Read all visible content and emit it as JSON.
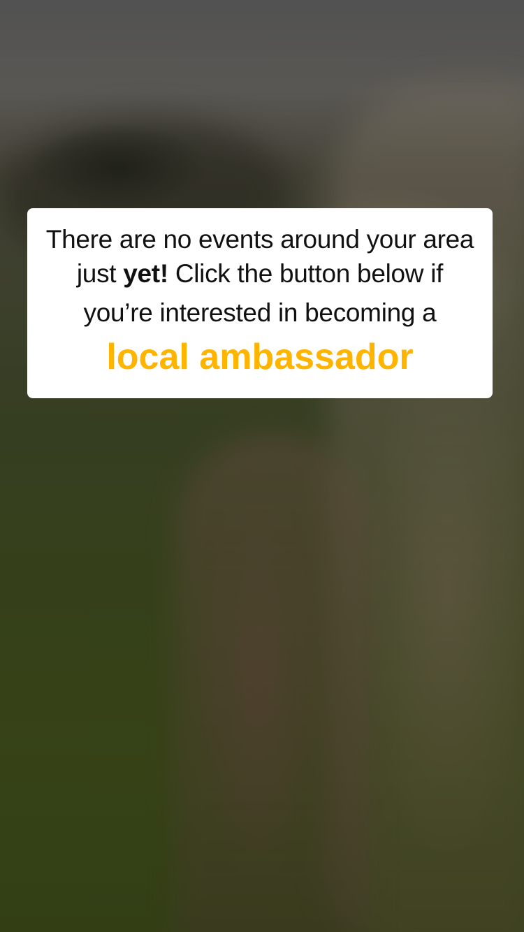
{
  "background": {
    "description_icon": "blurred-outdoor-photo",
    "overlay_color": "#000000"
  },
  "message_card": {
    "text_part1": "There are no events around your area just ",
    "text_bold": "yet!",
    "text_part2": " Click the button below if",
    "text_line3": "you’re interested in becoming a",
    "cta_label": "local ambassador",
    "cta_color": "#ffb400"
  }
}
